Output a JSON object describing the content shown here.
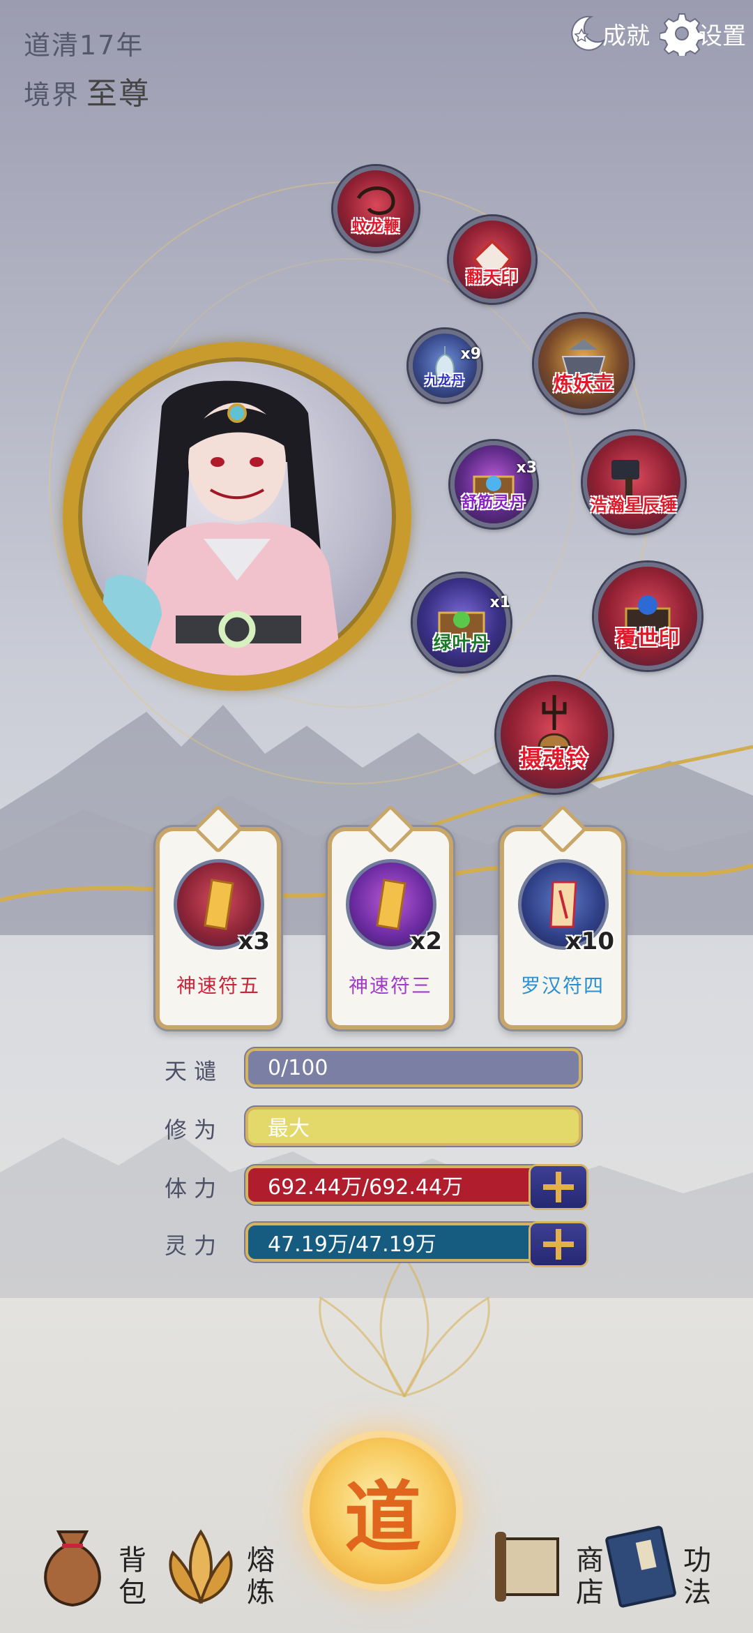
{
  "header": {
    "year_text": "道清17年",
    "realm_label": "境界",
    "realm_value": "至尊",
    "achievement_label": "成就",
    "settings_label": "设置"
  },
  "items": [
    {
      "name": "蚊龙鞭",
      "count": ""
    },
    {
      "name": "翻天印",
      "count": ""
    },
    {
      "name": "九龙丹",
      "count": "x9"
    },
    {
      "name": "炼妖壶",
      "count": ""
    },
    {
      "name": "舒筋灵丹",
      "count": "x3"
    },
    {
      "name": "浩瀚星辰锤",
      "count": ""
    },
    {
      "name": "绿叶丹",
      "count": "x1"
    },
    {
      "name": "覆世印",
      "count": ""
    },
    {
      "name": "摄魂铃",
      "count": ""
    }
  ],
  "talismans": [
    {
      "name": "神速符五",
      "count": "x3",
      "color": "#c8243a"
    },
    {
      "name": "神速符三",
      "count": "x2",
      "color": "#a23cc8"
    },
    {
      "name": "罗汉符四",
      "count": "x10",
      "color": "#2a8fd0"
    }
  ],
  "stats": [
    {
      "label": "天谴",
      "value": "0/100",
      "color": "#7b7fa3"
    },
    {
      "label": "修为",
      "value": "最大",
      "color": "#e3d96a"
    },
    {
      "label": "体力",
      "value": "692.44万/692.44万",
      "color": "#b01d2c"
    },
    {
      "label": "灵力",
      "value": "47.19万/47.19万",
      "color": "#155c80"
    }
  ],
  "nav": {
    "bag_label": "背包",
    "smelt_label": "熔炼",
    "dao_label": "道",
    "shop_label": "商店",
    "skills_label": "功法"
  },
  "colors": {
    "item_text": "#e01a2a",
    "gold": "#c89b2c"
  }
}
